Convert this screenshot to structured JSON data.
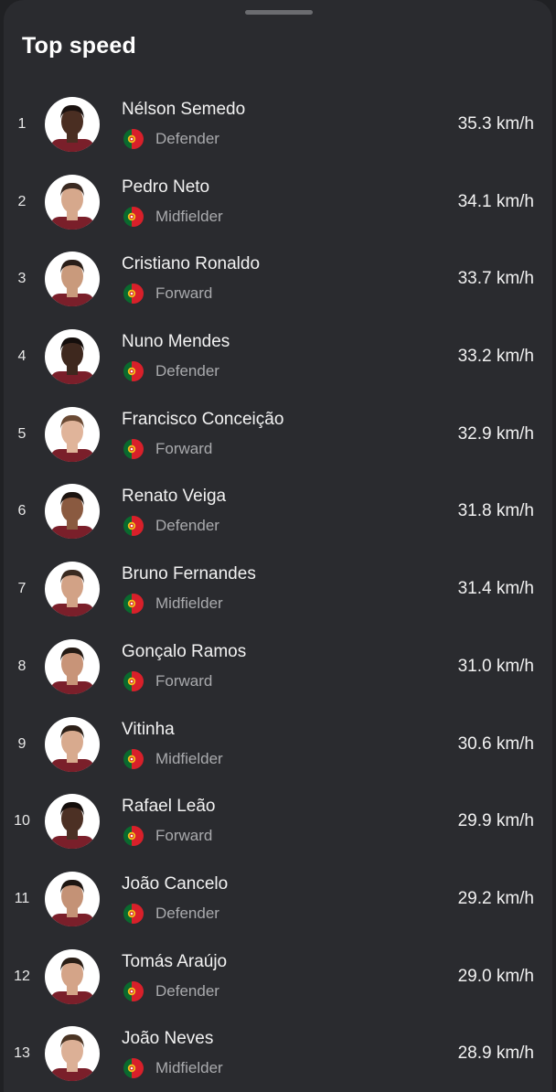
{
  "header": {
    "title": "Top speed"
  },
  "colors": {
    "background": "#2a2b2f",
    "text": "#ffffff",
    "secondary_text": "#a9aaad",
    "avatar_bg": "#ffffff"
  },
  "icons": {
    "flag": "portugal-flag-icon",
    "avatar": "player-avatar"
  },
  "players": [
    {
      "rank": "1",
      "name": "Nélson Semedo",
      "position": "Defender",
      "speed": "35.3 km/h",
      "skin": "#4a2e22",
      "hair": "#1a1210"
    },
    {
      "rank": "2",
      "name": "Pedro Neto",
      "position": "Midfielder",
      "speed": "34.1 km/h",
      "skin": "#d6a88c",
      "hair": "#3a2a22"
    },
    {
      "rank": "3",
      "name": "Cristiano Ronaldo",
      "position": "Forward",
      "speed": "33.7 km/h",
      "skin": "#c99a7c",
      "hair": "#2a1e18"
    },
    {
      "rank": "4",
      "name": "Nuno Mendes",
      "position": "Defender",
      "speed": "33.2 km/h",
      "skin": "#3e281e",
      "hair": "#140e0c"
    },
    {
      "rank": "5",
      "name": "Francisco Conceição",
      "position": "Forward",
      "speed": "32.9 km/h",
      "skin": "#e0b49a",
      "hair": "#6a4a34"
    },
    {
      "rank": "6",
      "name": "Renato Veiga",
      "position": "Defender",
      "speed": "31.8 km/h",
      "skin": "#8a5a40",
      "hair": "#1c1410"
    },
    {
      "rank": "7",
      "name": "Bruno Fernandes",
      "position": "Midfielder",
      "speed": "31.4 km/h",
      "skin": "#d2a286",
      "hair": "#3a2a20"
    },
    {
      "rank": "8",
      "name": "Gonçalo Ramos",
      "position": "Forward",
      "speed": "31.0 km/h",
      "skin": "#c89478",
      "hair": "#241a14"
    },
    {
      "rank": "9",
      "name": "Vitinha",
      "position": "Midfielder",
      "speed": "30.6 km/h",
      "skin": "#d8aa8e",
      "hair": "#2c2018"
    },
    {
      "rank": "10",
      "name": "Rafael Leão",
      "position": "Forward",
      "speed": "29.9 km/h",
      "skin": "#4c3024",
      "hair": "#140e0c"
    },
    {
      "rank": "11",
      "name": "João Cancelo",
      "position": "Defender",
      "speed": "29.2 km/h",
      "skin": "#c49276",
      "hair": "#1e1612"
    },
    {
      "rank": "12",
      "name": "Tomás Araújo",
      "position": "Defender",
      "speed": "29.0 km/h",
      "skin": "#d4a488",
      "hair": "#2a1e16"
    },
    {
      "rank": "13",
      "name": "João Neves",
      "position": "Midfielder",
      "speed": "28.9 km/h",
      "skin": "#dcb096",
      "hair": "#4a3424"
    }
  ]
}
